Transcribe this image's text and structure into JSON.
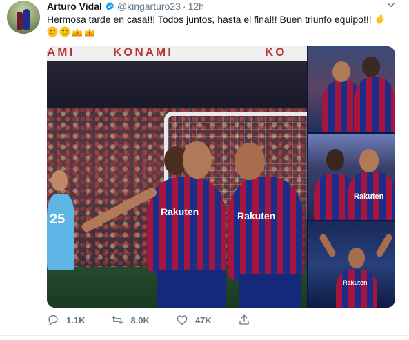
{
  "tweet": {
    "display_name": "Arturo Vidal",
    "handle": "@kingarturo23",
    "separator": "·",
    "time": "12h",
    "text": "Hermosa tarde en casa!!! Todos juntos, hasta el final!! Buen triunfo equipo!!!",
    "emojis": [
      "wave-hand-emoji",
      "wink-emoji",
      "wink-emoji",
      "crown-emoji",
      "crown-emoji"
    ]
  },
  "media": {
    "banner_text": "KONAMI",
    "banner_fragment_left": "AMI",
    "banner_fragment_right": "KO",
    "sponsor": "Rakuten",
    "jersey_number": "25"
  },
  "actions": {
    "replies": "1.1K",
    "retweets": "8.0K",
    "likes": "47K"
  },
  "colors": {
    "text": "#14171a",
    "secondary": "#657786",
    "verified": "#1da1f2",
    "barca_red": "#a5153d",
    "barca_blue": "#1b2f8a"
  }
}
